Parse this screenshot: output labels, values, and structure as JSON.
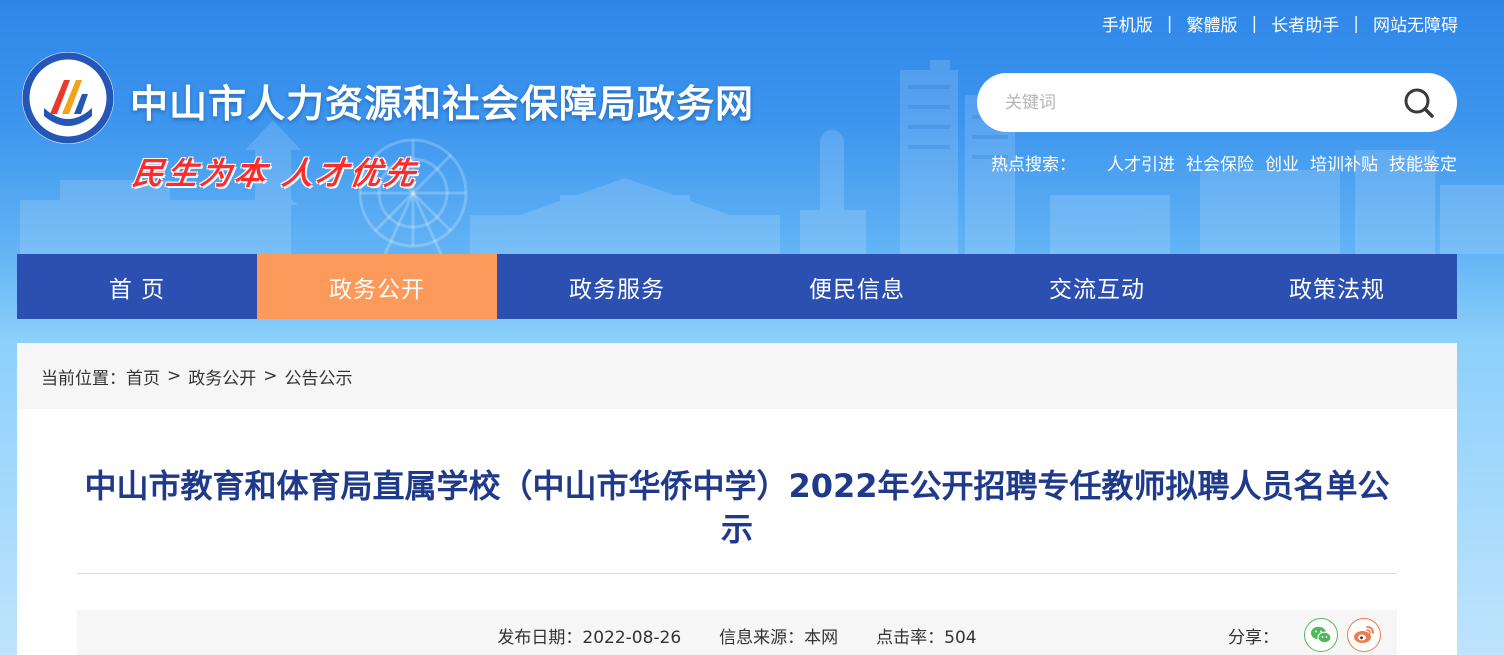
{
  "top_links": [
    "手机版",
    "繁體版",
    "长者助手",
    "网站无障碍"
  ],
  "top_links_separator": "|",
  "site": {
    "title": "中山市人力资源和社会保障局政务网",
    "slogan": "民生为本 人才优先"
  },
  "search": {
    "placeholder": "关键词",
    "hot_label": "热点搜索：",
    "hot_items": [
      "人才引进",
      "社会保险",
      "创业",
      "培训补贴",
      "技能鉴定"
    ]
  },
  "nav": {
    "items": [
      "首 页",
      "政务公开",
      "政务服务",
      "便民信息",
      "交流互动",
      "政策法规"
    ],
    "active_index": 1
  },
  "breadcrumb": {
    "label": "当前位置：",
    "items": [
      "首页",
      "政务公开",
      "公告公示"
    ],
    "separator": ">"
  },
  "article": {
    "title": "中山市教育和体育局直属学校（中山市华侨中学）2022年公开招聘专任教师拟聘人员名单公示",
    "publish_date_label": "发布日期：",
    "publish_date": "2022-08-26",
    "source_label": "信息来源：",
    "source": "本网",
    "clicks_label": "点击率：",
    "clicks": "504",
    "share_label": "分享："
  },
  "icons": {
    "search": "search-icon",
    "wechat": "wechat-icon",
    "weibo": "weibo-icon",
    "emblem": "bureau-emblem-icon"
  },
  "colors": {
    "nav_bg": "#2c50b1",
    "nav_active": "#fb9a5b",
    "title_blue": "#1f3a8a",
    "slogan_red": "#ff2a2a"
  }
}
